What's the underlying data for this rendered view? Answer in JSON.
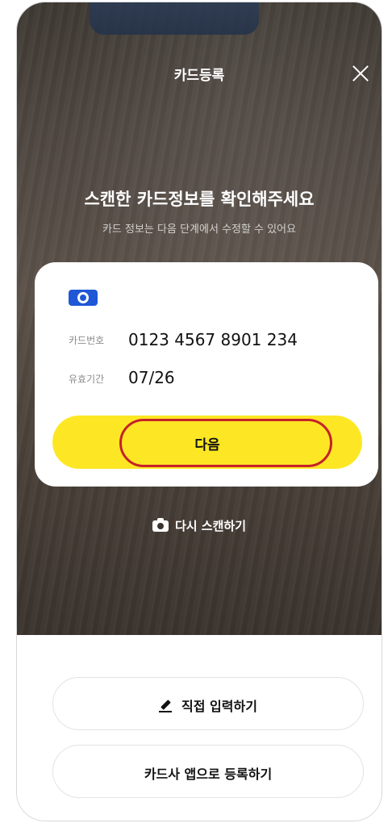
{
  "header": {
    "title": "카드등록",
    "close_icon": "close-icon"
  },
  "scan": {
    "headline": "스캔한 카드정보를 확인해주세요",
    "subline": "카드 정보는 다음 단계에서 수정할 수 있어요"
  },
  "card_info": {
    "brand_icon": "globe-icon",
    "number_label": "카드번호",
    "number_value": "0123 4567 8901 234",
    "expiry_label": "유효기간",
    "expiry_value": "07/26",
    "next_button": "다음"
  },
  "rescan": {
    "label": "다시 스캔하기",
    "icon": "camera-icon"
  },
  "bottom": {
    "manual_entry": "직접 입력하기",
    "manual_icon": "pencil-icon",
    "card_app_register": "카드사 앱으로 등록하기"
  },
  "colors": {
    "accent_yellow": "#fde724",
    "brand_blue": "#1f57d6",
    "highlight_red": "#c5222b"
  }
}
